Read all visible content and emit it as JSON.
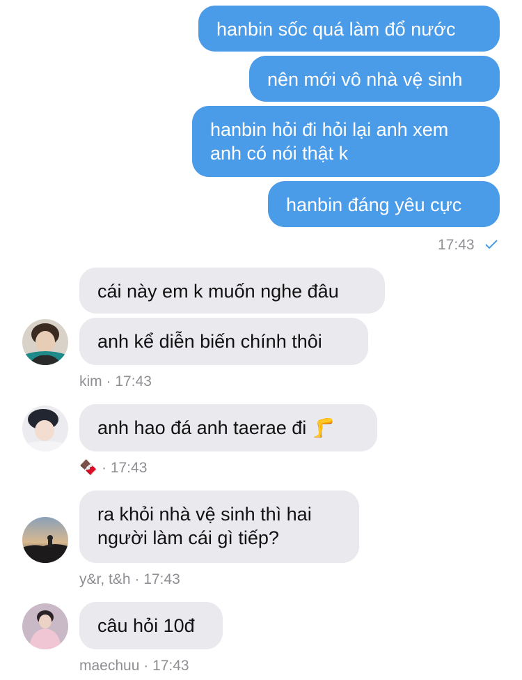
{
  "outgoing": [
    {
      "text": "hanbin sốc quá làm đổ nước"
    },
    {
      "text": "nên mới vô nhà vệ sinh"
    },
    {
      "text": "hanbin hỏi đi hỏi lại anh xem anh có nói thật k"
    },
    {
      "text": "hanbin đáng yêu cực"
    }
  ],
  "outgoing_time": "17:43",
  "groups": [
    {
      "sender": "kim",
      "time": "17:43",
      "messages": [
        "cái này em k muốn nghe đâu",
        "anh kể diễn biến chính thôi"
      ]
    },
    {
      "sender": "🍫",
      "time": "17:43",
      "messages": [
        "anh hao đá anh taerae đi 🦵"
      ]
    },
    {
      "sender": "y&r, t&h",
      "time": "17:43",
      "messages": [
        "ra khỏi nhà vệ sinh thì hai người làm cái gì tiếp?"
      ]
    },
    {
      "sender": "maechuu",
      "time": "17:43",
      "messages": [
        "câu hỏi 10đ"
      ]
    }
  ],
  "separator": " · ",
  "colors": {
    "outgoing_bubble": "#4a9be8",
    "incoming_bubble": "#e9e9ee",
    "meta_text": "#8e8e93",
    "check": "#4a9be8"
  },
  "icons": {
    "read_receipt": "check-icon"
  }
}
